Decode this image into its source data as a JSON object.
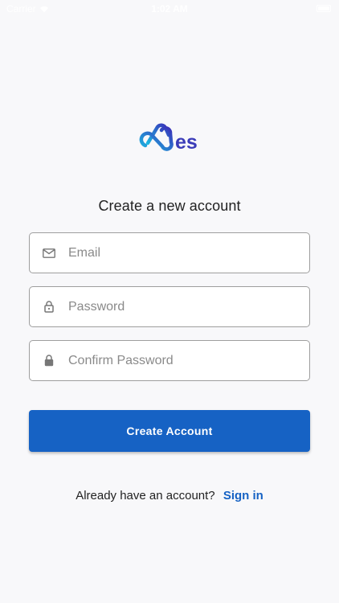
{
  "status_bar": {
    "carrier": "Carrier",
    "time": "1:02 AM"
  },
  "brand": {
    "logo_text": "es",
    "colors": {
      "gradient_start": "#1cb5e0",
      "gradient_end": "#3a2fb8",
      "text": "#3a3bb8"
    }
  },
  "page": {
    "title": "Create a new account"
  },
  "form": {
    "email": {
      "placeholder": "Email",
      "value": "",
      "icon": "mail-icon"
    },
    "password": {
      "placeholder": "Password",
      "value": "",
      "icon": "lock-outline-icon"
    },
    "confirm_password": {
      "placeholder": "Confirm Password",
      "value": "",
      "icon": "lock-icon"
    },
    "submit_label": "Create Account"
  },
  "footer": {
    "prompt": "Already have an account?",
    "link_label": "Sign in"
  },
  "colors": {
    "accent": "#1662c4",
    "background": "#f8f8fa",
    "border": "#9e9e9e"
  }
}
